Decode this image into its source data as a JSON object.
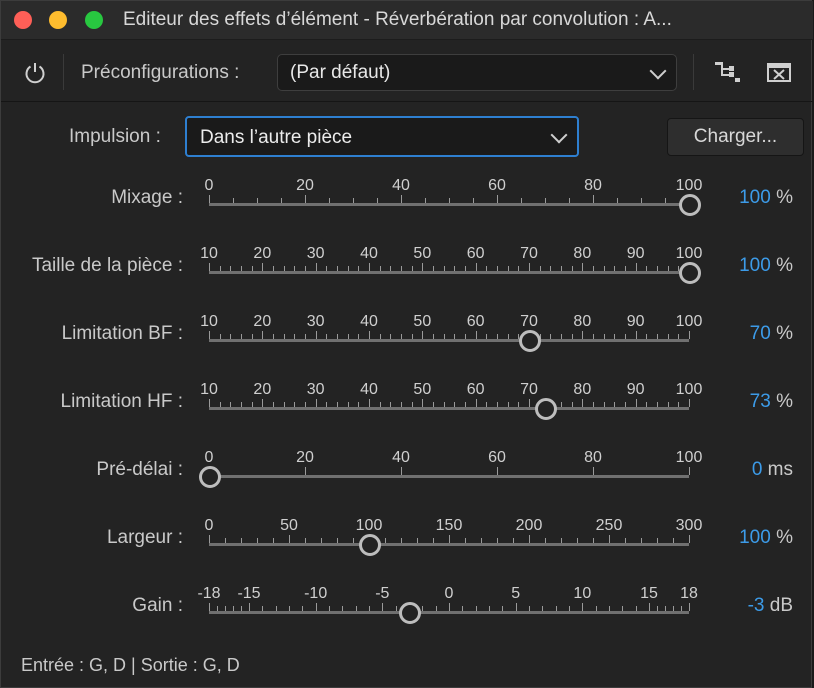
{
  "window": {
    "title": "Editeur des effets d’élément - Réverbération par convolution : A..."
  },
  "toolbar": {
    "power_icon": "power-icon",
    "presets_label": "Préconfigurations :",
    "presets_value": "(Par défaut)",
    "route_icon": "channel-routing-icon",
    "close_icon": "close-panel-icon"
  },
  "impulse": {
    "label": "Impulsion :",
    "value": "Dans l’autre pièce",
    "load_label": "Charger..."
  },
  "sliders": [
    {
      "label": "Mixage :",
      "ticks": [
        "0",
        "20",
        "40",
        "60",
        "80",
        "100"
      ],
      "min": 0,
      "max": 100,
      "minor_per_major": 3,
      "value": 100,
      "value_text": "100",
      "unit": "%"
    },
    {
      "label": "Taille de la pièce :",
      "ticks": [
        "10",
        "20",
        "30",
        "40",
        "50",
        "60",
        "70",
        "80",
        "90",
        "100"
      ],
      "min": 10,
      "max": 100,
      "minor_per_major": 4,
      "value": 100,
      "value_text": "100",
      "unit": "%"
    },
    {
      "label": "Limitation BF :",
      "ticks": [
        "10",
        "20",
        "30",
        "40",
        "50",
        "60",
        "70",
        "80",
        "90",
        "100"
      ],
      "min": 10,
      "max": 100,
      "minor_per_major": 4,
      "value": 70,
      "value_text": "70",
      "unit": "%"
    },
    {
      "label": "Limitation HF :",
      "ticks": [
        "10",
        "20",
        "30",
        "40",
        "50",
        "60",
        "70",
        "80",
        "90",
        "100"
      ],
      "min": 10,
      "max": 100,
      "minor_per_major": 4,
      "value": 73,
      "value_text": "73",
      "unit": "%"
    },
    {
      "label": "Pré-délai :",
      "ticks": [
        "0",
        "20",
        "40",
        "60",
        "80",
        "100"
      ],
      "min": 0,
      "max": 100,
      "minor_per_major": 0,
      "value": 0,
      "value_text": "0",
      "unit": "ms"
    },
    {
      "label": "Largeur :",
      "ticks": [
        "0",
        "50",
        "100",
        "150",
        "200",
        "250",
        "300"
      ],
      "min": 0,
      "max": 300,
      "minor_per_major": 4,
      "value": 100,
      "value_text": "100",
      "unit": "%"
    },
    {
      "label": "Gain :",
      "ticks": [
        "-18",
        "-15",
        "-10",
        "-5",
        "0",
        "5",
        "10",
        "15",
        "18"
      ],
      "min": -18,
      "max": 18,
      "minor_per_major": 4,
      "value": -3,
      "value_text": "-3",
      "unit": "dB"
    }
  ],
  "footer": "Entrée : G, D | Sortie : G, D",
  "colors": {
    "accent": "#3c9be8",
    "focus": "#2e7fd0",
    "background": "#232323"
  }
}
